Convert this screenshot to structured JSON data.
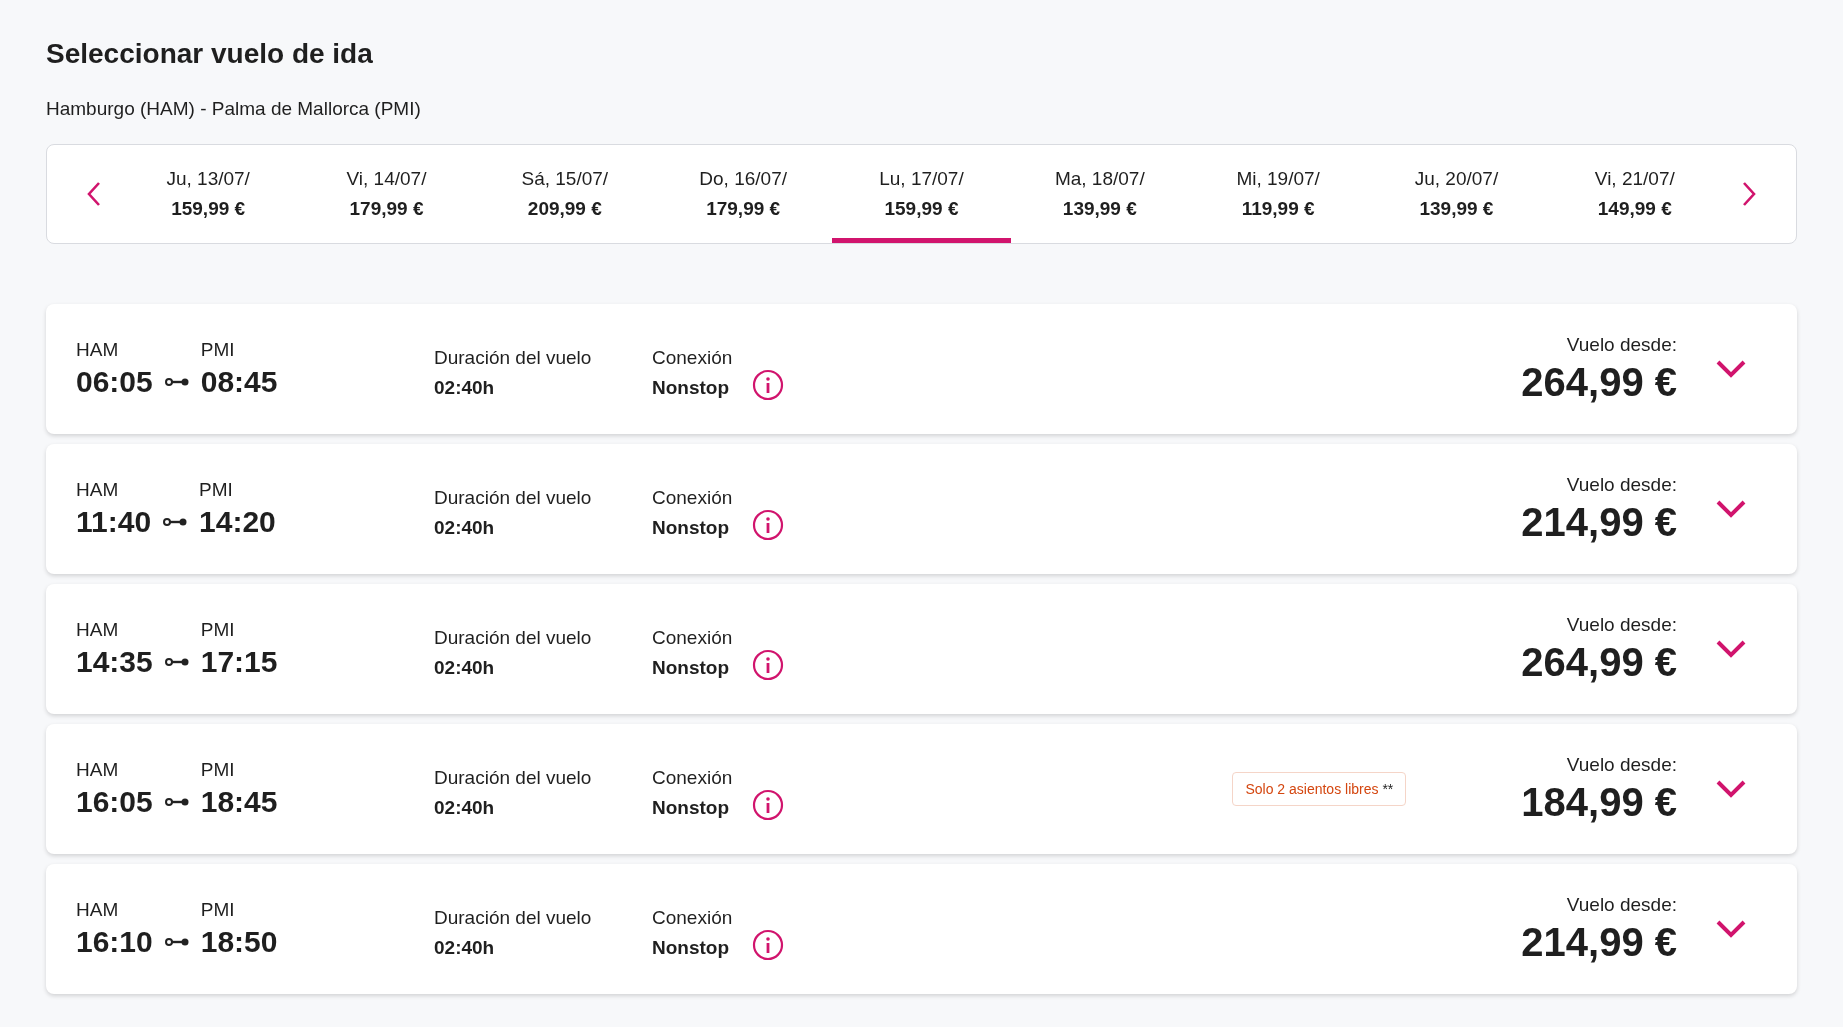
{
  "title": "Seleccionar vuelo de ida",
  "route": "Hamburgo (HAM) - Palma de Mallorca (PMI)",
  "dates": [
    {
      "day": "Ju, 13/07/",
      "price": "159,99 €",
      "selected": false
    },
    {
      "day": "Vi, 14/07/",
      "price": "179,99 €",
      "selected": false
    },
    {
      "day": "Sá, 15/07/",
      "price": "209,99 €",
      "selected": false
    },
    {
      "day": "Do, 16/07/",
      "price": "179,99 €",
      "selected": false
    },
    {
      "day": "Lu, 17/07/",
      "price": "159,99 €",
      "selected": true
    },
    {
      "day": "Ma, 18/07/",
      "price": "139,99 €",
      "selected": false
    },
    {
      "day": "Mi, 19/07/",
      "price": "119,99 €",
      "selected": false
    },
    {
      "day": "Ju, 20/07/",
      "price": "139,99 €",
      "selected": false
    },
    {
      "day": "Vi, 21/07/",
      "price": "149,99 €",
      "selected": false
    }
  ],
  "flights": [
    {
      "from": "HAM",
      "to": "PMI",
      "dep": "06:05",
      "arr": "08:45",
      "duration_label": "Duración del vuelo",
      "duration": "02:40h",
      "connection_label": "Conexión",
      "connection": "Nonstop",
      "price_label": "Vuelo desde:",
      "price": "264,99 €"
    },
    {
      "from": "HAM",
      "to": "PMI",
      "dep": "11:40",
      "arr": "14:20",
      "duration_label": "Duración del vuelo",
      "duration": "02:40h",
      "connection_label": "Conexión",
      "connection": "Nonstop",
      "price_label": "Vuelo desde:",
      "price": "214,99 €"
    },
    {
      "from": "HAM",
      "to": "PMI",
      "dep": "14:35",
      "arr": "17:15",
      "duration_label": "Duración del vuelo",
      "duration": "02:40h",
      "connection_label": "Conexión",
      "connection": "Nonstop",
      "price_label": "Vuelo desde:",
      "price": "264,99 €"
    },
    {
      "from": "HAM",
      "to": "PMI",
      "dep": "16:05",
      "arr": "18:45",
      "duration_label": "Duración del vuelo",
      "duration": "02:40h",
      "connection_label": "Conexión",
      "connection": "Nonstop",
      "seats_badge": {
        "text": "Solo 2 asientos libres",
        "note": "**"
      },
      "price_label": "Vuelo desde:",
      "price": "184,99 €"
    },
    {
      "from": "HAM",
      "to": "PMI",
      "dep": "16:10",
      "arr": "18:50",
      "duration_label": "Duración del vuelo",
      "duration": "02:40h",
      "connection_label": "Conexión",
      "connection": "Nonstop",
      "price_label": "Vuelo desde:",
      "price": "214,99 €"
    }
  ]
}
